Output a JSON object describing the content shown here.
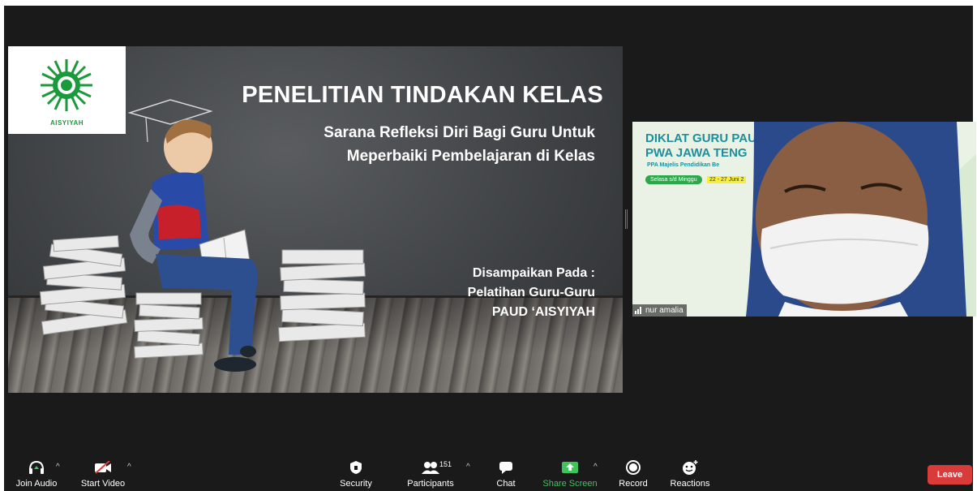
{
  "slide": {
    "logo_text": "AISYIYAH",
    "title": "PENELITIAN TINDAKAN KELAS",
    "subtitle_line1": "Sarana Refleksi Diri Bagi Guru Untuk",
    "subtitle_line2": "Meperbaiki Pembelajaran di Kelas",
    "credit_line1": "Disampaikan Pada :",
    "credit_line2": "Pelatihan Guru-Guru",
    "credit_line3": "PAUD ‘AISYIYAH"
  },
  "participant_video": {
    "bg_title1": "DIKLAT GURU PAU",
    "bg_title2": "PWA JAWA TENG",
    "bg_subtitle": "PPA Majelis Pendidikan Be",
    "bg_pill": "Selasa s/d Minggu",
    "bg_date": "22 - 27 Juni 2",
    "name": "nur amalia"
  },
  "toolbar": {
    "join_audio": "Join Audio",
    "start_video": "Start Video",
    "security": "Security",
    "participants": "Participants",
    "participants_count": "151",
    "chat": "Chat",
    "share_screen": "Share Screen",
    "record": "Record",
    "reactions": "Reactions",
    "leave": "Leave"
  },
  "colors": {
    "share_green": "#3dc45c",
    "leave_red": "#d93a3a"
  }
}
